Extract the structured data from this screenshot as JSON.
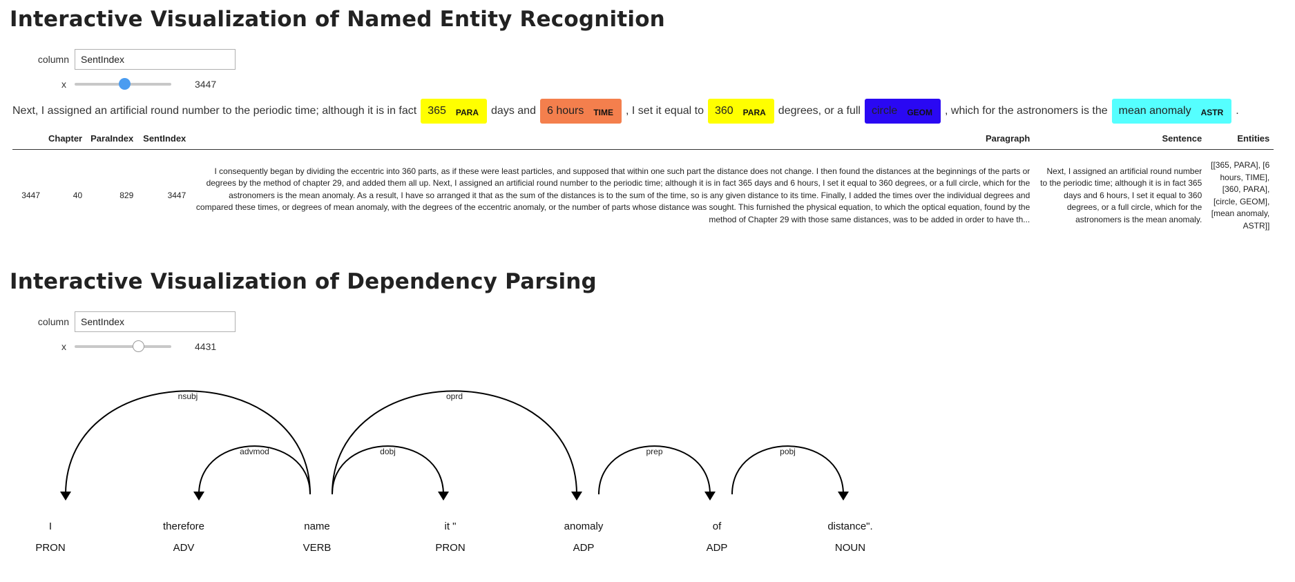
{
  "ner": {
    "title": "Interactive Visualization of Named Entity Recognition",
    "column_label": "column",
    "column_value": "SentIndex",
    "slider_label": "x",
    "slider_value": "3447",
    "slider_fraction": 0.52,
    "sentence": {
      "t0": "Next, I assigned an artificial round number to the periodic time; although it is in fact",
      "e1": {
        "text": "365",
        "label": "PARA",
        "color": "#ffff00"
      },
      "t1": "days and",
      "e2": {
        "text": "6 hours",
        "label": "TIME",
        "color": "#f47f4d"
      },
      "t2": ", I set it equal to",
      "e3": {
        "text": "360",
        "label": "PARA",
        "color": "#ffff00"
      },
      "t3": "degrees, or a full",
      "e4": {
        "text": "circle",
        "label": "GEOM",
        "color": "#2a08f3"
      },
      "t4": ", which for the astronomers is the",
      "e5": {
        "text": "mean anomaly",
        "label": "ASTR",
        "color": "#55ffff"
      },
      "t5": "."
    },
    "table": {
      "headers": [
        "",
        "Chapter",
        "ParaIndex",
        "SentIndex",
        "Paragraph",
        "Sentence",
        "Entities"
      ],
      "row": {
        "index": "3447",
        "chapter": "40",
        "paraindex": "829",
        "sentindex": "3447",
        "paragraph": "I consequently began by dividing the eccentric into 360 parts, as if these were least particles, and supposed that within one such part the distance does not change. I then found the distances at the beginnings of the parts or degrees by the method of chapter 29, and added them all up. Next, I assigned an artificial round number to the periodic time; although it is in fact 365 days and 6 hours, I set it equal to 360 degrees, or a full circle, which for the astronomers is the mean anomaly. As a result, I have so arranged it that as the sum of the distances is to the sum of the time, so is any given distance to its time. Finally, I added the times over the individual degrees and compared these times, or degrees of mean anomaly, with the degrees of the eccentric anomaly, or the number of parts whose distance was sought. This furnished the physical equation, to which the optical equation, found by the method of Chapter 29 with those same distances, was to be added in order to have th...",
        "sentence": "Next, I assigned an artificial round number to the periodic time; although it is in fact 365 days and 6 hours, I set it equal to 360 degrees, or a full circle, which for the astronomers is the mean anomaly.",
        "entities": "[[365, PARA], [6 hours, TIME], [360, PARA], [circle, GEOM], [mean anomaly, ASTR]]"
      }
    }
  },
  "dep": {
    "title": "Interactive Visualization of Dependency Parsing",
    "column_label": "column",
    "column_value": "SentIndex",
    "slider_label": "x",
    "slider_value": "4431",
    "slider_fraction": 0.66,
    "words": [
      {
        "text": "I",
        "tag": "PRON"
      },
      {
        "text": "therefore",
        "tag": "ADV"
      },
      {
        "text": "name",
        "tag": "VERB"
      },
      {
        "text": "it \"",
        "tag": "PRON"
      },
      {
        "text": "anomaly",
        "tag": "ADP"
      },
      {
        "text": "of",
        "tag": "ADP"
      },
      {
        "text": "distance\".",
        "tag": "NOUN"
      }
    ],
    "arcs": [
      {
        "start": 0,
        "end": 2,
        "label": "nsubj",
        "dir": "left"
      },
      {
        "start": 1,
        "end": 2,
        "label": "advmod",
        "dir": "left"
      },
      {
        "start": 2,
        "end": 3,
        "label": "dobj",
        "dir": "right"
      },
      {
        "start": 2,
        "end": 4,
        "label": "oprd",
        "dir": "right"
      },
      {
        "start": 4,
        "end": 5,
        "label": "prep",
        "dir": "right"
      },
      {
        "start": 5,
        "end": 6,
        "label": "pobj",
        "dir": "right"
      }
    ]
  }
}
